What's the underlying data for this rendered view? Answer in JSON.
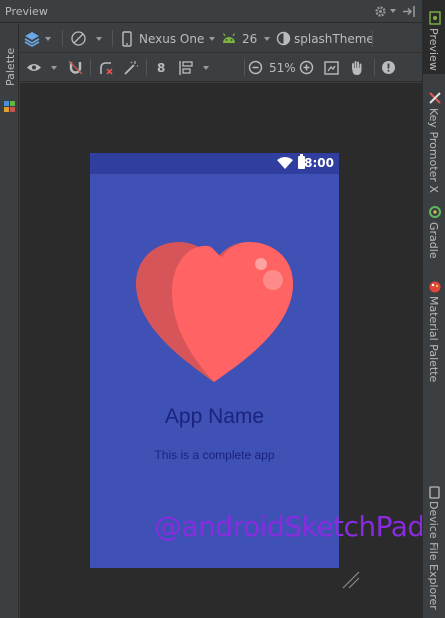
{
  "window": {
    "title": "Preview"
  },
  "left_panel": {
    "label": "Palette"
  },
  "right_panel": {
    "tabs": [
      {
        "label": "Preview"
      },
      {
        "label": "Key Promoter X"
      },
      {
        "label": "Gradle"
      },
      {
        "label": "Material Palette"
      },
      {
        "label": "Device File Explorer"
      }
    ]
  },
  "toolbar1": {
    "device": "Nexus One",
    "api_level": "26",
    "theme": "splashTheme"
  },
  "toolbar2": {
    "number": "8",
    "zoom": "51%"
  },
  "device_screen": {
    "status_time": "8:00",
    "app_name": "App Name",
    "tagline": "This is a complete app"
  },
  "watermark": "@androidSketchPad",
  "colors": {
    "ide_bg": "#3c3f41",
    "canvas_bg": "#2b2b2b",
    "screen_bg": "#3f51b5",
    "status_bar": "#303f9f",
    "heart": "#ff6363",
    "heart_shade": "#d65559",
    "text": "#1a237e",
    "watermark": "#8a2be2"
  }
}
